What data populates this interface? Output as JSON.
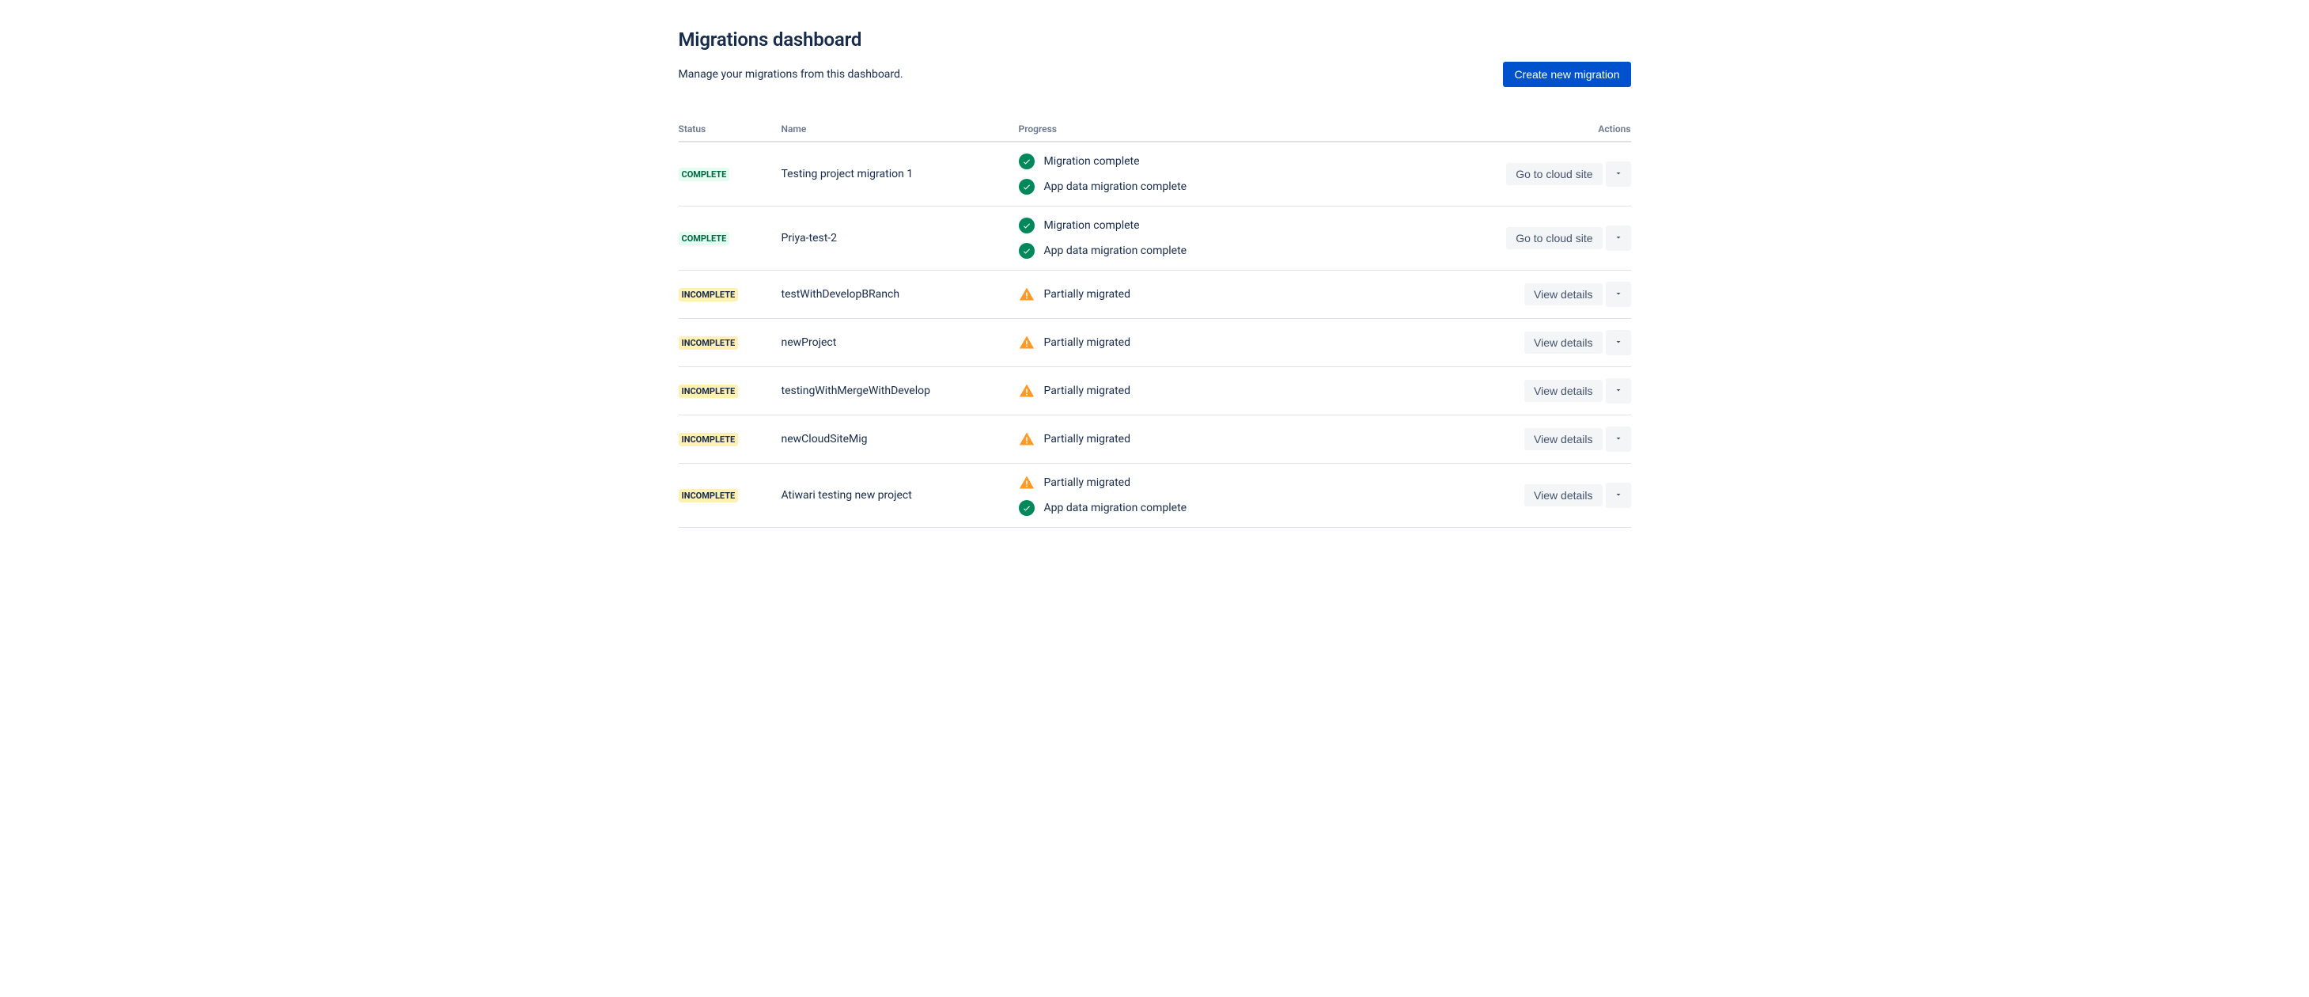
{
  "page": {
    "title": "Migrations dashboard",
    "subtitle": "Manage your migrations from this dashboard.",
    "create_button": "Create new migration"
  },
  "columns": {
    "status": "Status",
    "name": "Name",
    "progress": "Progress",
    "actions": "Actions"
  },
  "status_labels": {
    "complete": "COMPLETE",
    "incomplete": "INCOMPLETE"
  },
  "progress_messages": {
    "migration_complete": "Migration complete",
    "app_data_complete": "App data migration complete",
    "partially_migrated": "Partially migrated"
  },
  "action_labels": {
    "go_to_cloud": "Go to cloud site",
    "view_details": "View details"
  },
  "rows": [
    {
      "status": "complete",
      "name": "Testing project migration 1",
      "progress": [
        {
          "icon": "check",
          "msg_key": "migration_complete"
        },
        {
          "icon": "check",
          "msg_key": "app_data_complete"
        }
      ],
      "action_key": "go_to_cloud"
    },
    {
      "status": "complete",
      "name": "Priya-test-2",
      "progress": [
        {
          "icon": "check",
          "msg_key": "migration_complete"
        },
        {
          "icon": "check",
          "msg_key": "app_data_complete"
        }
      ],
      "action_key": "go_to_cloud"
    },
    {
      "status": "incomplete",
      "name": "testWithDevelopBRanch",
      "progress": [
        {
          "icon": "warn",
          "msg_key": "partially_migrated"
        }
      ],
      "action_key": "view_details"
    },
    {
      "status": "incomplete",
      "name": "newProject",
      "progress": [
        {
          "icon": "warn",
          "msg_key": "partially_migrated"
        }
      ],
      "action_key": "view_details"
    },
    {
      "status": "incomplete",
      "name": "testingWithMergeWithDevelop",
      "progress": [
        {
          "icon": "warn",
          "msg_key": "partially_migrated"
        }
      ],
      "action_key": "view_details"
    },
    {
      "status": "incomplete",
      "name": "newCloudSiteMig",
      "progress": [
        {
          "icon": "warn",
          "msg_key": "partially_migrated"
        }
      ],
      "action_key": "view_details"
    },
    {
      "status": "incomplete",
      "name": "Atiwari testing new project",
      "progress": [
        {
          "icon": "warn",
          "msg_key": "partially_migrated"
        },
        {
          "icon": "check",
          "msg_key": "app_data_complete"
        }
      ],
      "action_key": "view_details"
    }
  ]
}
